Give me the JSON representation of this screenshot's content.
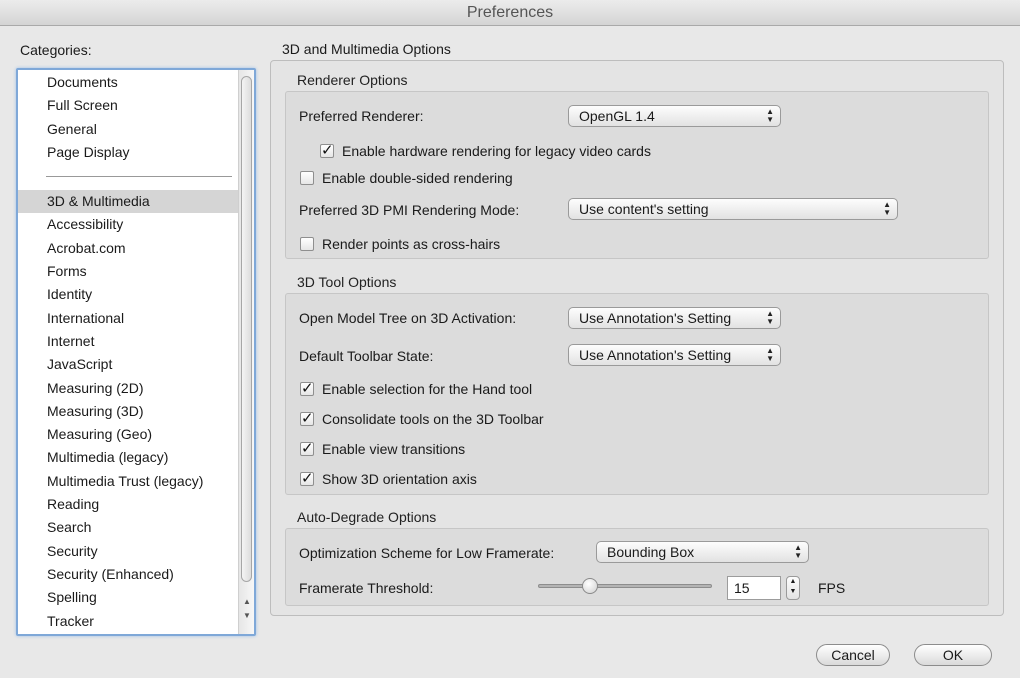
{
  "window": {
    "title": "Preferences"
  },
  "categories": {
    "label": "Categories:",
    "top_items": [
      "Documents",
      "Full Screen",
      "General",
      "Page Display"
    ],
    "items": [
      "3D & Multimedia",
      "Accessibility",
      "Acrobat.com",
      "Forms",
      "Identity",
      "International",
      "Internet",
      "JavaScript",
      "Measuring (2D)",
      "Measuring (3D)",
      "Measuring (Geo)",
      "Multimedia (legacy)",
      "Multimedia Trust (legacy)",
      "Reading",
      "Search",
      "Security",
      "Security (Enhanced)",
      "Spelling",
      "Tracker"
    ],
    "selected": "3D & Multimedia"
  },
  "main": {
    "title": "3D and Multimedia Options",
    "renderer": {
      "title": "Renderer Options",
      "preferred_renderer_label": "Preferred Renderer:",
      "preferred_renderer_value": "OpenGL 1.4",
      "hw_rendering_label": "Enable hardware rendering for legacy video cards",
      "hw_rendering_checked": true,
      "double_sided_label": "Enable double-sided rendering",
      "double_sided_checked": false,
      "pmi_mode_label": "Preferred 3D PMI Rendering Mode:",
      "pmi_mode_value": "Use content's setting",
      "cross_hairs_label": "Render points as cross-hairs",
      "cross_hairs_checked": false
    },
    "tool": {
      "title": "3D Tool Options",
      "model_tree_label": "Open Model Tree on 3D Activation:",
      "model_tree_value": "Use Annotation's Setting",
      "toolbar_state_label": "Default Toolbar State:",
      "toolbar_state_value": "Use Annotation's Setting",
      "hand_tool_label": "Enable selection for the Hand tool",
      "hand_tool_checked": true,
      "consolidate_label": "Consolidate tools on the 3D Toolbar",
      "consolidate_checked": true,
      "view_transitions_label": "Enable view transitions",
      "view_transitions_checked": true,
      "orientation_axis_label": "Show 3D orientation axis",
      "orientation_axis_checked": true
    },
    "degrade": {
      "title": "Auto-Degrade Options",
      "scheme_label": "Optimization Scheme for Low Framerate:",
      "scheme_value": "Bounding Box",
      "threshold_label": "Framerate Threshold:",
      "threshold_value": "15",
      "threshold_unit": "FPS",
      "slider_fraction": 0.3
    }
  },
  "buttons": {
    "cancel": "Cancel",
    "ok": "OK"
  }
}
